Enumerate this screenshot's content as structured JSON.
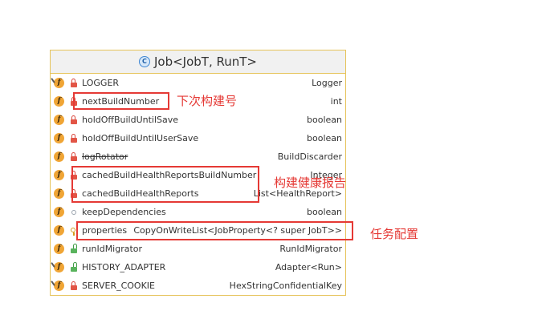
{
  "class_box": {
    "title": "Job<JobT, RunT>",
    "title_icon": "class-icon"
  },
  "fields": [
    {
      "name": "LOGGER",
      "type": "Logger",
      "icon": "static-field-icon",
      "is_static": true,
      "visibility_icon": "private-lock-icon"
    },
    {
      "name": "nextBuildNumber",
      "type": "int",
      "icon": "field-icon",
      "is_static": false,
      "visibility_icon": "private-lock-icon"
    },
    {
      "name": "holdOffBuildUntilSave",
      "type": "boolean",
      "icon": "field-icon",
      "is_static": false,
      "visibility_icon": "private-lock-icon"
    },
    {
      "name": "holdOffBuildUntilUserSave",
      "type": "boolean",
      "icon": "field-icon",
      "is_static": false,
      "visibility_icon": "private-lock-icon"
    },
    {
      "name": "logRotator",
      "type": "BuildDiscarder",
      "icon": "field-icon",
      "is_static": false,
      "visibility_icon": "private-lock-icon",
      "deprecated": true
    },
    {
      "name": "cachedBuildHealthReportsBuildNumber",
      "type": "Integer",
      "icon": "field-icon",
      "is_static": false,
      "visibility_icon": "private-lock-icon"
    },
    {
      "name": "cachedBuildHealthReports",
      "type": "List<HealthReport>",
      "icon": "field-icon",
      "is_static": false,
      "visibility_icon": "private-lock-icon"
    },
    {
      "name": "keepDependencies",
      "type": "boolean",
      "icon": "field-icon",
      "is_static": false,
      "visibility_icon": "package-private-icon"
    },
    {
      "name": "properties",
      "type": "CopyOnWriteList<JobProperty<? super JobT>>",
      "icon": "field-icon",
      "is_static": false,
      "visibility_icon": "protected-key-icon"
    },
    {
      "name": "runIdMigrator",
      "type": "RunIdMigrator",
      "icon": "field-icon",
      "is_static": false,
      "visibility_icon": "public-icon"
    },
    {
      "name": "HISTORY_ADAPTER",
      "type": "Adapter<Run>",
      "icon": "static-field-icon",
      "is_static": true,
      "visibility_icon": "public-icon"
    },
    {
      "name": "SERVER_COOKIE",
      "type": "HexStringConfidentialKey",
      "icon": "static-field-icon",
      "is_static": true,
      "visibility_icon": "private-lock-icon"
    }
  ],
  "annotations": [
    {
      "label": "下次构建号"
    },
    {
      "label": "构建健康报告"
    },
    {
      "label": "任务配置"
    }
  ],
  "colors": {
    "class_border": "#e6c35a",
    "header_bg": "#f1f1f1",
    "field_icon": "#f0a535",
    "annotation": "#e53935"
  }
}
